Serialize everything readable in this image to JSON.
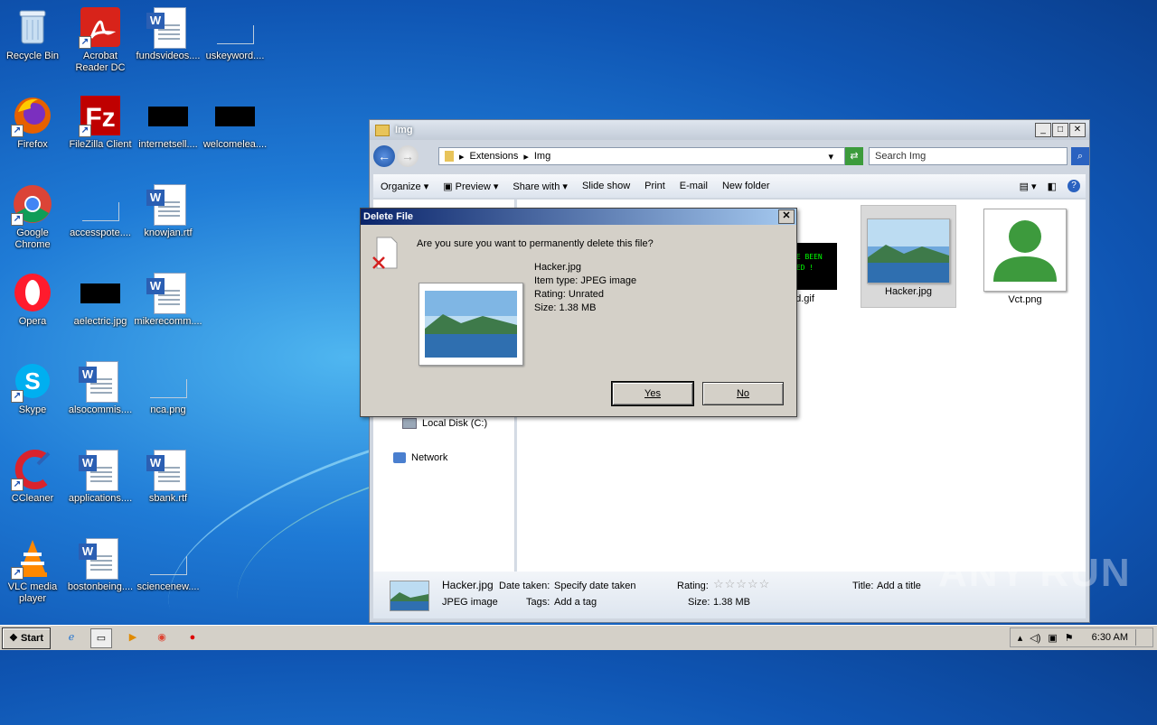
{
  "desktop": {
    "icons": [
      {
        "label": "Recycle Bin",
        "icon": "recycle-bin-icon"
      },
      {
        "label": "Acrobat Reader DC",
        "icon": "acrobat-icon"
      },
      {
        "label": "fundsvideos....",
        "icon": "word-doc-icon"
      },
      {
        "label": "uskeyword....",
        "icon": "blank-file-icon"
      },
      {
        "label": "Firefox",
        "icon": "firefox-icon"
      },
      {
        "label": "FileZilla Client",
        "icon": "filezilla-icon"
      },
      {
        "label": "internetsell....",
        "icon": "black-image-icon"
      },
      {
        "label": "welcomelea....",
        "icon": "black-image-icon"
      },
      {
        "label": "Google Chrome",
        "icon": "chrome-icon"
      },
      {
        "label": "accesspote....",
        "icon": "blank-file-icon"
      },
      {
        "label": "knowjan.rtf",
        "icon": "word-doc-icon"
      },
      {
        "label": "Opera",
        "icon": "opera-icon"
      },
      {
        "label": "aelectric.jpg",
        "icon": "black-image-icon"
      },
      {
        "label": "mikerecomm....",
        "icon": "word-doc-icon"
      },
      {
        "label": "Skype",
        "icon": "skype-icon"
      },
      {
        "label": "alsocommis....",
        "icon": "word-doc-icon"
      },
      {
        "label": "nca.png",
        "icon": "blank-file-icon"
      },
      {
        "label": "CCleaner",
        "icon": "ccleaner-icon"
      },
      {
        "label": "applications....",
        "icon": "word-doc-icon"
      },
      {
        "label": "sbank.rtf",
        "icon": "word-doc-icon"
      },
      {
        "label": "VLC media player",
        "icon": "vlc-icon"
      },
      {
        "label": "bostonbeing....",
        "icon": "word-doc-icon"
      },
      {
        "label": "sciencenew....",
        "icon": "blank-file-icon"
      }
    ]
  },
  "explorer": {
    "title": "Img",
    "breadcrumb": [
      "Extensions",
      "Img"
    ],
    "search_placeholder": "Search Img",
    "toolbar": {
      "organize": "Organize",
      "preview": "Preview",
      "share_with": "Share with",
      "slide_show": "Slide show",
      "print": "Print",
      "email": "E-mail",
      "new_folder": "New folder"
    },
    "nav": {
      "local_disk": "Local Disk (C:)",
      "network": "Network"
    },
    "files": [
      {
        "name": "ed.gif"
      },
      {
        "name": "Hacker.jpg"
      },
      {
        "name": "Vct.png"
      }
    ],
    "gif_text": "VE BEEN\nKED !",
    "details": {
      "filename": "Hacker.jpg",
      "filetype": "JPEG image",
      "date_taken_label": "Date taken:",
      "date_taken_value": "Specify date taken",
      "tags_label": "Tags:",
      "tags_value": "Add a tag",
      "rating_label": "Rating:",
      "size_label": "Size:",
      "size_value": "1.38 MB",
      "title_label": "Title:",
      "title_value": "Add a title"
    }
  },
  "dialog": {
    "title": "Delete File",
    "question": "Are you sure you want to permanently delete this file?",
    "file_name": "Hacker.jpg",
    "item_type": "Item type: JPEG image",
    "rating": "Rating: Unrated",
    "size": "Size: 1.38 MB",
    "yes_label": "Yes",
    "no_label": "No"
  },
  "taskbar": {
    "start_label": "Start",
    "clock": "6:30 AM"
  },
  "watermark": "ANY RUN"
}
